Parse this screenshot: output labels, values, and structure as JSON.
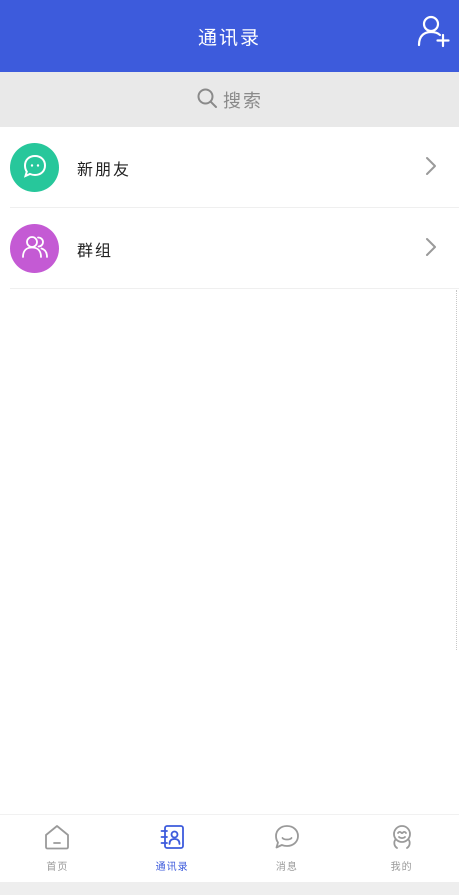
{
  "header": {
    "title": "通讯录",
    "add_icon": "add-contact-icon"
  },
  "search": {
    "label": "搜索",
    "icon": "search-icon"
  },
  "list": {
    "items": [
      {
        "label": "新朋友",
        "icon": "chat-bubble-icon",
        "color": "#27c79b"
      },
      {
        "label": "群组",
        "icon": "group-icon",
        "color": "#c45ad4"
      }
    ]
  },
  "nav": {
    "items": [
      {
        "label": "首页",
        "icon": "home-icon",
        "active": false
      },
      {
        "label": "通讯录",
        "icon": "contacts-icon",
        "active": true
      },
      {
        "label": "消息",
        "icon": "message-icon",
        "active": false
      },
      {
        "label": "我的",
        "icon": "profile-icon",
        "active": false
      }
    ]
  },
  "colors": {
    "primary": "#3d5bdc",
    "inactive": "#9a9a9a",
    "search_bg": "#e9e9e9"
  }
}
